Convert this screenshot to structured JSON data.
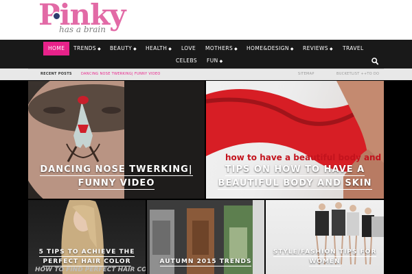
{
  "logo": {
    "main": "Pinky",
    "sub": "has a brain"
  },
  "nav": {
    "items": [
      {
        "label": "HOME",
        "caret": ""
      },
      {
        "label": "TRENDS",
        "caret": "◆"
      },
      {
        "label": "BEAUTY",
        "caret": "◆"
      },
      {
        "label": "HEALTH",
        "caret": "◆"
      },
      {
        "label": "LOVE",
        "caret": ""
      },
      {
        "label": "MOTHERS",
        "caret": "◆"
      },
      {
        "label": "HOME&DESIGN",
        "caret": "◆"
      },
      {
        "label": "REVIEWS",
        "caret": "◆"
      },
      {
        "label": "TRAVEL",
        "caret": ""
      },
      {
        "label": "CELEBS",
        "caret": ""
      },
      {
        "label": "FUN",
        "caret": "◆"
      }
    ],
    "search_icon": "search-icon",
    "accent": "#e8228a"
  },
  "recent": {
    "label": "RECENT POSTS",
    "post": "DANCING NOSE TWERKING| FUNNY VIDEO",
    "links": [
      "SITEMAP",
      "BUCKETLIST ++TO DO"
    ]
  },
  "tiles": [
    {
      "title": "DANCING NOSE TWERKING| FUNNY VIDEO"
    },
    {
      "title": "TIPS ON HOW TO HAVE A BEAUTIFUL BODY AND SKIN",
      "image_text": "how to have a beautiful body and skin"
    },
    {
      "title": "5 TIPS TO ACHIEVE THE PERFECT HAIR COLOR",
      "image_text": "HOW TO FIND PERFECT HAIR COLOR"
    },
    {
      "title": "AUTUMN 2015 TRENDS"
    },
    {
      "title": "STYLE/FASHION TIPS FOR WOMEN"
    }
  ]
}
